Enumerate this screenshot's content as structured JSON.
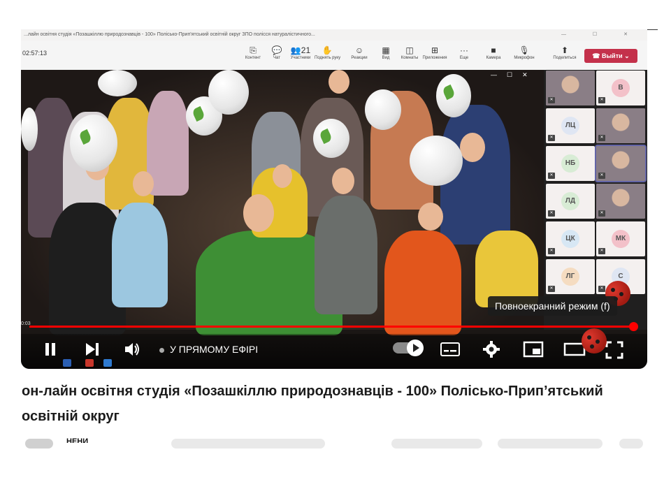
{
  "teams": {
    "window_title": "...лайн освітня студія «Позашкіллю природознавців - 100» Полісько-Прип'ятський освітній округ ЗПО полісся натуралістичного...",
    "timer": "02:57:13",
    "toolbar": [
      {
        "icon": "content-icon",
        "glyph": "⎘",
        "label": "Контент"
      },
      {
        "icon": "chat-icon",
        "glyph": "💬",
        "label": "Чат"
      },
      {
        "icon": "people-icon",
        "glyph": "👥",
        "label": "Участники",
        "count": "21"
      },
      {
        "icon": "hand-icon",
        "glyph": "✋",
        "label": "Поднять руку"
      },
      {
        "icon": "reaction-icon",
        "glyph": "☺",
        "label": "Реакции"
      },
      {
        "icon": "view-icon",
        "glyph": "▦",
        "label": "Вид"
      },
      {
        "icon": "rooms-icon",
        "glyph": "◫",
        "label": "Комнаты"
      },
      {
        "icon": "apps-icon",
        "glyph": "⊞",
        "label": "Приложения"
      },
      {
        "icon": "more-icon",
        "glyph": "···",
        "label": "Еще"
      },
      {
        "icon": "camera-icon",
        "glyph": "■",
        "label": "Камера"
      },
      {
        "icon": "mic-icon",
        "glyph": "🎙",
        "label": "Микрофон"
      },
      {
        "icon": "share-icon",
        "glyph": "⬆",
        "label": "Поделиться"
      }
    ],
    "leave_label": "Выйти",
    "participants": [
      {
        "initials": "",
        "photo": true
      },
      {
        "initials": "В",
        "color": "#f3c1c9"
      },
      {
        "initials": "ЛЦ",
        "color": "#dfe6f3"
      },
      {
        "initials": "",
        "photo": true
      },
      {
        "initials": "НБ",
        "color": "#d8ecd5"
      },
      {
        "initials": "",
        "photo": true
      },
      {
        "initials": "ЛД",
        "color": "#d8ecd5"
      },
      {
        "initials": "",
        "photo": true
      },
      {
        "initials": "ЦК",
        "color": "#d7e7f4"
      },
      {
        "initials": "МК",
        "color": "#f3c1c9"
      },
      {
        "initials": "ЛГ",
        "color": "#f5dcc1"
      },
      {
        "initials": "С",
        "color": "#dfe6f3"
      }
    ]
  },
  "player": {
    "tooltip": "Повноекранний режим (f)",
    "live_label": "У ПРЯМОМУ ЕФІРІ",
    "progress": 1.0,
    "accent": "#ff0000"
  },
  "video": {
    "title": "он-лайн освітня студія «Позашкіллю природознавців - 100» Полісько-Прип’ятський освітній округ"
  },
  "below": {
    "channel_partial": "НЕНИ"
  }
}
